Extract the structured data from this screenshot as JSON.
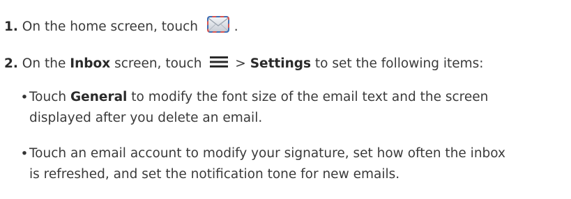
{
  "steps": [
    {
      "number": "1.",
      "text_before": "On the home screen, touch",
      "icon": "email-envelope-icon",
      "text_after": "."
    },
    {
      "number": "2.",
      "text_a": "On the",
      "bold_a": "Inbox",
      "text_b": "screen, touch",
      "icon": "menu-icon",
      "text_c": ">",
      "bold_b": "Settings",
      "text_d": "to set the following items:"
    }
  ],
  "bullets": [
    {
      "text_before": "Touch",
      "bold": "General",
      "line1_after": "to modify the font size of the email text and the screen",
      "line2": "displayed after you delete an email."
    },
    {
      "line1": "Touch an email account to modify your signature, set how often the inbox",
      "line2": "is refreshed, and set the notification tone for new emails."
    }
  ],
  "bullet_glyph": "•",
  "colors": {
    "text": "#3a3a3a",
    "envelope_border_red": "#d9534f",
    "envelope_border_blue": "#3b6fb6"
  }
}
